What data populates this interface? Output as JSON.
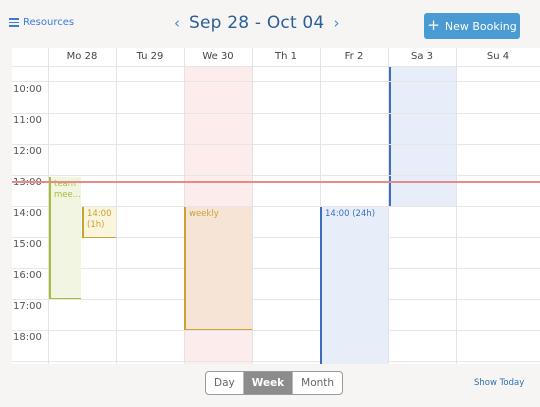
{
  "header": {
    "resources_label": "Resources",
    "prev_arrow": "‹",
    "next_arrow": "›",
    "date_range": "Sep 28 - Oct 04",
    "new_booking_label": "New Booking",
    "new_booking_icon": "+"
  },
  "days": [
    "Mo 28",
    "Tu 29",
    "We 30",
    "Th 1",
    "Fr 2",
    "Sa 3",
    "Su 4"
  ],
  "hours": [
    "10:00",
    "11:00",
    "12:00",
    "13:00",
    "14:00",
    "15:00",
    "16:00",
    "17:00",
    "18:00"
  ],
  "events": {
    "team_meeting": "team mee...",
    "mo_1400_time": "14:00",
    "mo_1400_duration": "(1h)",
    "weekly": "weekly",
    "fr_1400": "14:00 (24h)"
  },
  "footer": {
    "views": [
      "Day",
      "Week",
      "Month"
    ],
    "active_view": "Week",
    "show_today": "Show Today"
  },
  "colors": {
    "accent": "#4a9ad4",
    "now_line": "#e98a8a",
    "olive": "#a9bc3a",
    "mustard": "#c9a233",
    "blue_event": "#3a6fc0"
  }
}
